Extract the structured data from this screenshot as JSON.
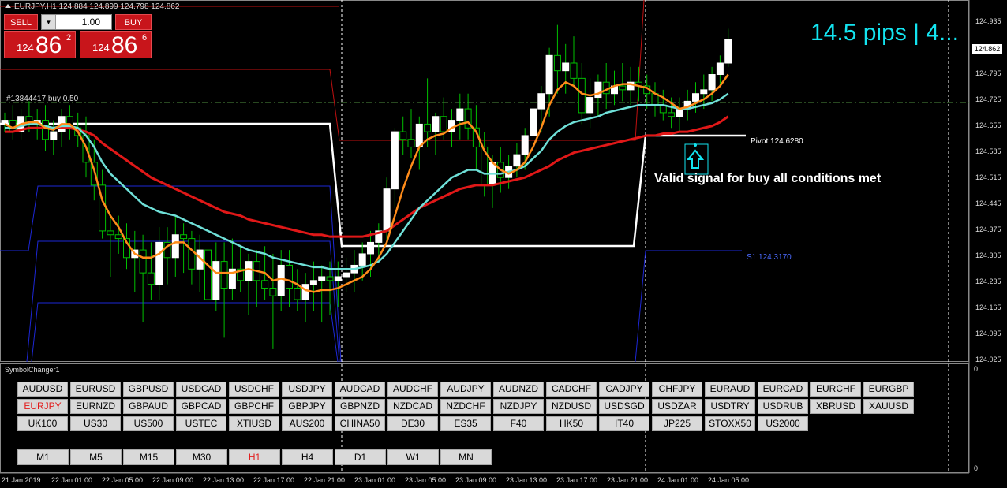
{
  "header": {
    "title": "EURJPY,H1  124.884 124.899 124.798 124.862"
  },
  "one_click": {
    "sell_label": "SELL",
    "buy_label": "BUY",
    "lots": "1.00",
    "lots_arrow": "▾",
    "sell_price": {
      "prefix": "124",
      "big": "86",
      "sup": "2"
    },
    "buy_price": {
      "prefix": "124",
      "big": "86",
      "sup": "6"
    }
  },
  "overlay": {
    "pips_text": "14.5 pips | 4...",
    "order_label": "#13844417 buy 0.50",
    "pivot_label": "Pivot 124.6280",
    "s1_label": "S1 124.3170",
    "signal_text": "Valid signal for buy all conditions met"
  },
  "colors": {
    "ema_fast": "#ff8c1a",
    "ema_mid": "#6fe0d8",
    "ema_slow": "#e01818",
    "pips": "#13e4f0",
    "bull": "#ffffff",
    "bear": "#00c000",
    "active": "#e21c1c"
  },
  "icons": {
    "signal_arrow": "up-arrow-icon",
    "header_toggle": "triangle-up-icon"
  },
  "price_axis": {
    "ticks": [
      "124.935",
      "124.862",
      "124.795",
      "124.725",
      "124.655",
      "124.585",
      "124.515",
      "124.445",
      "124.375",
      "124.305",
      "124.235",
      "124.165",
      "124.095",
      "124.025"
    ],
    "current": "124.862"
  },
  "indicator_axis": {
    "top": "0",
    "bottom": "0"
  },
  "time_axis": [
    "21 Jan 2019",
    "22 Jan 01:00",
    "22 Jan 05:00",
    "22 Jan 09:00",
    "22 Jan 13:00",
    "22 Jan 17:00",
    "22 Jan 21:00",
    "23 Jan 01:00",
    "23 Jan 05:00",
    "23 Jan 09:00",
    "23 Jan 13:00",
    "23 Jan 17:00",
    "23 Jan 21:00",
    "24 Jan 01:00",
    "24 Jan 05:00"
  ],
  "symbol_changer": {
    "title": "SymbolChanger1",
    "active": "EURJPY",
    "rows": [
      [
        "AUDUSD",
        "EURUSD",
        "GBPUSD",
        "USDCAD",
        "USDCHF",
        "USDJPY",
        "AUDCAD",
        "AUDCHF",
        "AUDJPY",
        "AUDNZD",
        "CADCHF",
        "CADJPY",
        "CHFJPY",
        "EURAUD",
        "EURCAD",
        "EURCHF",
        "EURGBP"
      ],
      [
        "EURJPY",
        "EURNZD",
        "GBPAUD",
        "GBPCAD",
        "GBPCHF",
        "GBPJPY",
        "GBPNZD",
        "NZDCAD",
        "NZDCHF",
        "NZDJPY",
        "NZDUSD",
        "USDSGD",
        "USDZAR",
        "USDTRY",
        "USDRUB",
        "XBRUSD",
        "XAUUSD"
      ],
      [
        "UK100",
        "US30",
        "US500",
        "USTEC",
        "XTIUSD",
        "AUS200",
        "CHINA50",
        "DE30",
        "ES35",
        "F40",
        "HK50",
        "IT40",
        "JP225",
        "STOXX50",
        "US2000"
      ]
    ],
    "timeframes": [
      "M1",
      "M5",
      "M15",
      "M30",
      "H1",
      "H4",
      "D1",
      "W1",
      "MN"
    ],
    "active_tf": "H1"
  },
  "chart_data": {
    "type": "candlestick",
    "symbol": "EURJPY",
    "timeframe": "H1",
    "ylim": [
      124.025,
      124.955
    ],
    "candles": [
      [
        124.64,
        124.67,
        124.62,
        124.65
      ],
      [
        124.65,
        124.69,
        124.6,
        124.62
      ],
      [
        124.62,
        124.68,
        124.6,
        124.66
      ],
      [
        124.66,
        124.7,
        124.62,
        124.64
      ],
      [
        124.64,
        124.68,
        124.6,
        124.65
      ],
      [
        124.65,
        124.69,
        124.57,
        124.6
      ],
      [
        124.6,
        124.65,
        124.56,
        124.62
      ],
      [
        124.62,
        124.68,
        124.58,
        124.66
      ],
      [
        124.66,
        124.69,
        124.6,
        124.63
      ],
      [
        124.63,
        124.67,
        124.58,
        124.61
      ],
      [
        124.61,
        124.66,
        124.5,
        124.54
      ],
      [
        124.54,
        124.6,
        124.44,
        124.48
      ],
      [
        124.48,
        124.52,
        124.34,
        124.36
      ],
      [
        124.36,
        124.4,
        124.24,
        124.35
      ],
      [
        124.35,
        124.4,
        124.3,
        124.34
      ],
      [
        124.34,
        124.38,
        124.26,
        124.29
      ],
      [
        124.29,
        124.36,
        124.2,
        124.31
      ],
      [
        124.31,
        124.35,
        124.12,
        124.25
      ],
      [
        124.25,
        124.33,
        124.18,
        124.22
      ],
      [
        124.22,
        124.37,
        124.18,
        124.33
      ],
      [
        124.33,
        124.37,
        124.22,
        124.29
      ],
      [
        124.29,
        124.4,
        124.24,
        124.35
      ],
      [
        124.35,
        124.38,
        124.25,
        124.34
      ],
      [
        124.34,
        124.36,
        124.22,
        124.26
      ],
      [
        124.26,
        124.35,
        124.2,
        124.31
      ],
      [
        124.31,
        124.35,
        124.1,
        124.18
      ],
      [
        124.18,
        124.33,
        124.15,
        124.28
      ],
      [
        124.28,
        124.33,
        124.08,
        124.21
      ],
      [
        124.21,
        124.34,
        124.18,
        124.26
      ],
      [
        124.26,
        124.32,
        124.2,
        124.23
      ],
      [
        124.23,
        124.3,
        124.14,
        124.28
      ],
      [
        124.28,
        124.31,
        124.16,
        124.23
      ],
      [
        124.23,
        124.32,
        124.18,
        124.21
      ],
      [
        124.21,
        124.3,
        124.05,
        124.19
      ],
      [
        124.19,
        124.31,
        124.15,
        124.27
      ],
      [
        124.27,
        124.31,
        124.16,
        124.21
      ],
      [
        124.21,
        124.26,
        124.15,
        124.18
      ],
      [
        124.18,
        124.25,
        124.12,
        124.22
      ],
      [
        124.22,
        124.28,
        124.15,
        124.23
      ],
      [
        124.23,
        124.27,
        124.12,
        124.24
      ],
      [
        124.24,
        124.28,
        124.14,
        124.23
      ],
      [
        124.23,
        124.28,
        124.16,
        124.24
      ],
      [
        124.24,
        124.29,
        124.2,
        124.25
      ],
      [
        124.25,
        124.31,
        124.2,
        124.27
      ],
      [
        124.27,
        124.33,
        124.23,
        124.3
      ],
      [
        124.3,
        124.36,
        124.24,
        124.33
      ],
      [
        124.33,
        124.38,
        124.28,
        124.36
      ],
      [
        124.36,
        124.5,
        124.33,
        124.47
      ],
      [
        124.47,
        124.63,
        124.42,
        124.62
      ],
      [
        124.62,
        124.66,
        124.56,
        124.6
      ],
      [
        124.6,
        124.68,
        124.55,
        124.58
      ],
      [
        124.58,
        124.66,
        124.52,
        124.64
      ],
      [
        124.64,
        124.76,
        124.58,
        124.62
      ],
      [
        124.62,
        124.67,
        124.56,
        124.66
      ],
      [
        124.66,
        124.71,
        124.6,
        124.62
      ],
      [
        124.62,
        124.68,
        124.58,
        124.65
      ],
      [
        124.65,
        124.72,
        124.6,
        124.68
      ],
      [
        124.68,
        124.72,
        124.6,
        124.63
      ],
      [
        124.63,
        124.69,
        124.52,
        124.58
      ],
      [
        124.58,
        124.62,
        124.45,
        124.48
      ],
      [
        124.48,
        124.56,
        124.42,
        124.54
      ],
      [
        124.54,
        124.58,
        124.46,
        124.5
      ],
      [
        124.5,
        124.56,
        124.47,
        124.53
      ],
      [
        124.53,
        124.59,
        124.5,
        124.56
      ],
      [
        124.56,
        124.63,
        124.52,
        124.61
      ],
      [
        124.61,
        124.7,
        124.56,
        124.68
      ],
      [
        124.68,
        124.74,
        124.62,
        124.72
      ],
      [
        124.72,
        124.84,
        124.66,
        124.82
      ],
      [
        124.82,
        124.9,
        124.72,
        124.78
      ],
      [
        124.78,
        124.85,
        124.72,
        124.8
      ],
      [
        124.8,
        124.87,
        124.74,
        124.76
      ],
      [
        124.76,
        124.8,
        124.64,
        124.67
      ],
      [
        124.67,
        124.76,
        124.63,
        124.71
      ],
      [
        124.71,
        124.77,
        124.66,
        124.75
      ],
      [
        124.75,
        124.8,
        124.68,
        124.72
      ],
      [
        124.72,
        124.78,
        124.69,
        124.74
      ],
      [
        124.74,
        124.8,
        124.7,
        124.73
      ],
      [
        124.73,
        124.79,
        124.69,
        124.75
      ],
      [
        124.75,
        124.79,
        124.7,
        124.74
      ],
      [
        124.74,
        124.77,
        124.68,
        124.72
      ],
      [
        124.72,
        124.75,
        124.66,
        124.69
      ],
      [
        124.69,
        124.73,
        124.65,
        124.67
      ],
      [
        124.67,
        124.71,
        124.63,
        124.66
      ],
      [
        124.66,
        124.71,
        124.62,
        124.68
      ],
      [
        124.68,
        124.73,
        124.65,
        124.7
      ],
      [
        124.7,
        124.75,
        124.67,
        124.72
      ],
      [
        124.72,
        124.77,
        124.68,
        124.73
      ],
      [
        124.73,
        124.79,
        124.7,
        124.77
      ],
      [
        124.77,
        124.82,
        124.74,
        124.8
      ],
      [
        124.8,
        124.89,
        124.79,
        124.862
      ]
    ],
    "ema_fast": [
      124.64,
      124.63,
      124.64,
      124.645,
      124.645,
      124.63,
      124.625,
      124.64,
      124.64,
      124.62,
      124.58,
      124.52,
      124.44,
      124.4,
      124.37,
      124.33,
      124.3,
      124.29,
      124.29,
      124.3,
      124.32,
      124.33,
      124.33,
      124.31,
      124.29,
      124.27,
      124.25,
      124.25,
      124.25,
      124.255,
      124.26,
      124.255,
      124.25,
      124.23,
      124.235,
      124.23,
      124.22,
      124.205,
      124.2,
      124.205,
      124.205,
      124.21,
      124.22,
      124.23,
      124.24,
      124.26,
      124.29,
      124.33,
      124.4,
      124.47,
      124.53,
      124.58,
      124.6,
      124.61,
      124.615,
      124.63,
      124.64,
      124.645,
      124.62,
      124.57,
      124.54,
      124.52,
      124.51,
      124.52,
      124.54,
      124.58,
      124.63,
      124.69,
      124.73,
      124.75,
      124.74,
      124.72,
      124.715,
      124.72,
      124.73,
      124.74,
      124.745,
      124.745,
      124.74,
      124.735,
      124.72,
      124.71,
      124.695,
      124.68,
      124.685,
      124.695,
      124.705,
      124.72,
      124.74,
      124.77
    ],
    "ema_mid": [
      124.63,
      124.63,
      124.635,
      124.64,
      124.64,
      124.635,
      124.63,
      124.635,
      124.635,
      124.63,
      124.61,
      124.58,
      124.54,
      124.51,
      124.49,
      124.47,
      124.45,
      124.43,
      124.42,
      124.41,
      124.405,
      124.4,
      124.39,
      124.38,
      124.37,
      124.36,
      124.35,
      124.34,
      124.33,
      124.32,
      124.31,
      124.305,
      124.3,
      124.29,
      124.285,
      124.28,
      124.275,
      124.27,
      124.265,
      124.265,
      124.26,
      124.26,
      124.26,
      124.26,
      124.265,
      124.27,
      124.28,
      124.3,
      124.33,
      124.36,
      124.39,
      124.42,
      124.44,
      124.46,
      124.48,
      124.5,
      124.51,
      124.52,
      124.52,
      124.51,
      124.51,
      124.51,
      124.515,
      124.52,
      124.53,
      124.55,
      124.57,
      124.6,
      124.62,
      124.635,
      124.645,
      124.65,
      124.655,
      124.66,
      124.67,
      124.675,
      124.68,
      124.685,
      124.69,
      124.69,
      124.69,
      124.69,
      124.685,
      124.68,
      124.68,
      124.685,
      124.69,
      124.695,
      124.705,
      124.72
    ],
    "ema_slow": [
      124.62,
      124.62,
      124.625,
      124.63,
      124.63,
      124.63,
      124.63,
      124.63,
      124.63,
      124.625,
      124.62,
      124.61,
      124.59,
      124.575,
      124.56,
      124.545,
      124.53,
      124.515,
      124.5,
      124.49,
      124.48,
      124.47,
      124.46,
      124.45,
      124.44,
      124.43,
      124.42,
      124.41,
      124.405,
      124.4,
      124.39,
      124.385,
      124.38,
      124.375,
      124.37,
      124.365,
      124.36,
      124.355,
      124.35,
      124.35,
      124.345,
      124.345,
      124.345,
      124.345,
      124.345,
      124.35,
      124.355,
      124.36,
      124.375,
      124.39,
      124.405,
      124.42,
      124.43,
      124.44,
      124.45,
      124.46,
      124.47,
      124.475,
      124.48,
      124.48,
      124.48,
      124.485,
      124.49,
      124.495,
      124.5,
      124.51,
      124.52,
      124.53,
      124.545,
      124.555,
      124.565,
      124.57,
      124.575,
      124.58,
      124.585,
      124.59,
      124.595,
      124.6,
      124.605,
      124.61,
      124.61,
      124.615,
      124.615,
      124.62,
      124.62,
      124.625,
      124.63,
      124.635,
      124.645,
      124.66
    ]
  }
}
